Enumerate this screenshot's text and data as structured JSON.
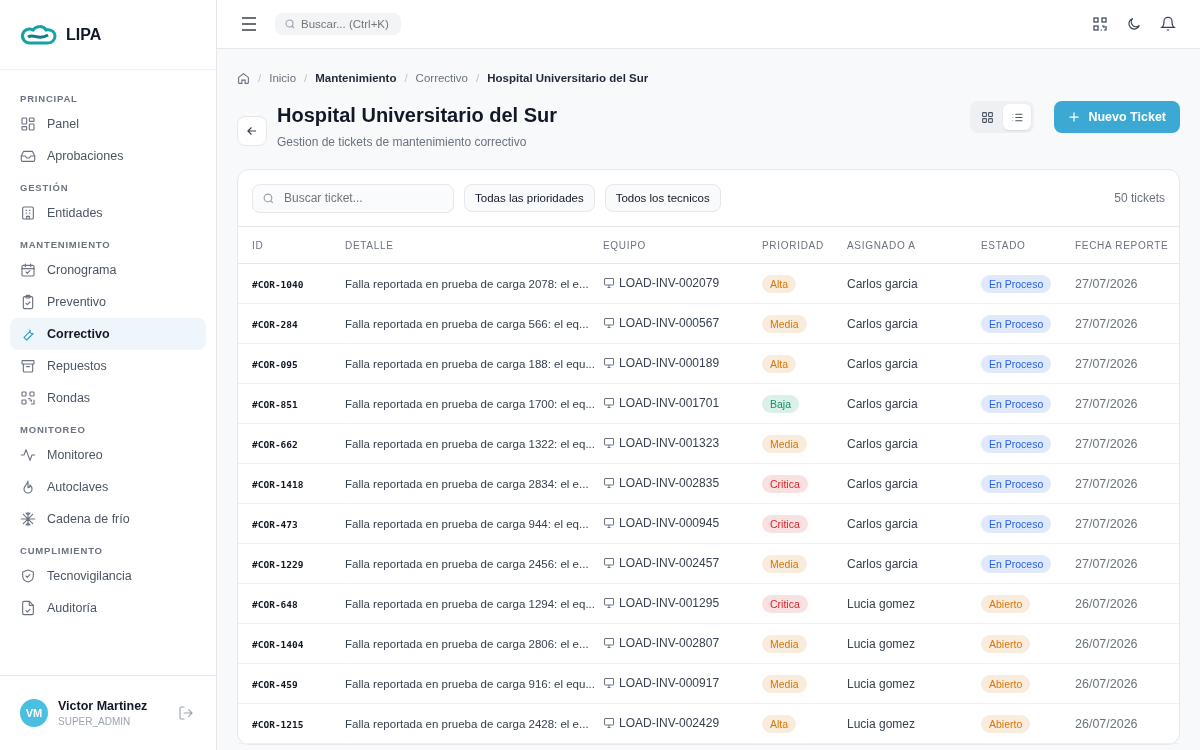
{
  "brand": {
    "name": "LIPA"
  },
  "sidebar": {
    "sections": [
      {
        "title": "PRINCIPAL",
        "items": [
          {
            "label": "Panel",
            "selected": false
          },
          {
            "label": "Aprobaciones",
            "selected": false
          }
        ]
      },
      {
        "title": "GESTIÓN",
        "items": [
          {
            "label": "Entidades",
            "selected": false
          }
        ]
      },
      {
        "title": "MANTENIMIENTO",
        "items": [
          {
            "label": "Cronograma",
            "selected": false
          },
          {
            "label": "Preventivo",
            "selected": false
          },
          {
            "label": "Correctivo",
            "selected": true
          },
          {
            "label": "Repuestos",
            "selected": false
          },
          {
            "label": "Rondas",
            "selected": false
          }
        ]
      },
      {
        "title": "MONITOREO",
        "items": [
          {
            "label": "Monitoreo",
            "selected": false
          },
          {
            "label": "Autoclaves",
            "selected": false
          },
          {
            "label": "Cadena de frío",
            "selected": false
          }
        ]
      },
      {
        "title": "CUMPLIMIENTO",
        "items": [
          {
            "label": "Tecnovigilancia",
            "selected": false
          },
          {
            "label": "Auditoría",
            "selected": false
          }
        ]
      }
    ]
  },
  "user": {
    "initials": "VM",
    "name": "Victor Martinez",
    "role": "SUPER_ADMIN"
  },
  "topbar": {
    "search": {
      "placeholder": "Buscar... (Ctrl+K)"
    }
  },
  "breadcrumb": {
    "separator": "/",
    "items": [
      {
        "label": "Inicio",
        "bold": false
      },
      {
        "label": "Mantenimiento",
        "bold": true
      },
      {
        "label": "Correctivo",
        "bold": false
      },
      {
        "label": "Hospital Universitario del Sur",
        "bold": true
      }
    ]
  },
  "page": {
    "title": "Hospital Universitario del Sur",
    "subtitle": "Gestion de tickets de mantenimiento correctivo"
  },
  "view_toggle": [
    {
      "kind": "grid",
      "selected": false
    },
    {
      "kind": "list",
      "selected": true
    }
  ],
  "new_button": {
    "label": "Nuevo Ticket"
  },
  "filters": {
    "search": {
      "placeholder": "Buscar ticket..."
    },
    "priority": "Todas las prioridades",
    "technician": "Todos los tecnicos",
    "count": "50 tickets"
  },
  "table": {
    "columns": [
      "ID",
      "DETALLE",
      "EQUIPO",
      "PRIORIDAD",
      "ASIGNADO A",
      "ESTADO",
      "FECHA REPORTE"
    ],
    "rows": [
      {
        "id": "#COR-1040",
        "detail": "Falla reportada en prueba de carga 2078: el e...",
        "equipment": "LOAD-INV-002079",
        "priority": {
          "label": "Alta",
          "color": "#d97706"
        },
        "assignee": "Carlos garcia",
        "status": {
          "label": "En Proceso",
          "color": "#2563eb"
        },
        "date": "27/07/2026"
      },
      {
        "id": "#COR-284",
        "detail": "Falla reportada en prueba de carga 566: el eq...",
        "equipment": "LOAD-INV-000567",
        "priority": {
          "label": "Media",
          "color": "#d97706"
        },
        "assignee": "Carlos garcia",
        "status": {
          "label": "En Proceso",
          "color": "#2563eb"
        },
        "date": "27/07/2026"
      },
      {
        "id": "#COR-095",
        "detail": "Falla reportada en prueba de carga 188: el equ...",
        "equipment": "LOAD-INV-000189",
        "priority": {
          "label": "Alta",
          "color": "#d97706"
        },
        "assignee": "Carlos garcia",
        "status": {
          "label": "En Proceso",
          "color": "#2563eb"
        },
        "date": "27/07/2026"
      },
      {
        "id": "#COR-851",
        "detail": "Falla reportada en prueba de carga 1700: el eq...",
        "equipment": "LOAD-INV-001701",
        "priority": {
          "label": "Baja",
          "color": "#059669"
        },
        "assignee": "Carlos garcia",
        "status": {
          "label": "En Proceso",
          "color": "#2563eb"
        },
        "date": "27/07/2026"
      },
      {
        "id": "#COR-662",
        "detail": "Falla reportada en prueba de carga 1322: el eq...",
        "equipment": "LOAD-INV-001323",
        "priority": {
          "label": "Media",
          "color": "#d97706"
        },
        "assignee": "Carlos garcia",
        "status": {
          "label": "En Proceso",
          "color": "#2563eb"
        },
        "date": "27/07/2026"
      },
      {
        "id": "#COR-1418",
        "detail": "Falla reportada en prueba de carga 2834: el e...",
        "equipment": "LOAD-INV-002835",
        "priority": {
          "label": "Critica",
          "color": "#dc2626"
        },
        "assignee": "Carlos garcia",
        "status": {
          "label": "En Proceso",
          "color": "#2563eb"
        },
        "date": "27/07/2026"
      },
      {
        "id": "#COR-473",
        "detail": "Falla reportada en prueba de carga 944: el eq...",
        "equipment": "LOAD-INV-000945",
        "priority": {
          "label": "Critica",
          "color": "#dc2626"
        },
        "assignee": "Carlos garcia",
        "status": {
          "label": "En Proceso",
          "color": "#2563eb"
        },
        "date": "27/07/2026"
      },
      {
        "id": "#COR-1229",
        "detail": "Falla reportada en prueba de carga 2456: el e...",
        "equipment": "LOAD-INV-002457",
        "priority": {
          "label": "Media",
          "color": "#d97706"
        },
        "assignee": "Carlos garcia",
        "status": {
          "label": "En Proceso",
          "color": "#2563eb"
        },
        "date": "27/07/2026"
      },
      {
        "id": "#COR-648",
        "detail": "Falla reportada en prueba de carga 1294: el eq...",
        "equipment": "LOAD-INV-001295",
        "priority": {
          "label": "Critica",
          "color": "#dc2626"
        },
        "assignee": "Lucia gomez",
        "status": {
          "label": "Abierto",
          "color": "#d97706"
        },
        "date": "26/07/2026"
      },
      {
        "id": "#COR-1404",
        "detail": "Falla reportada en prueba de carga 2806: el e...",
        "equipment": "LOAD-INV-002807",
        "priority": {
          "label": "Media",
          "color": "#d97706"
        },
        "assignee": "Lucia gomez",
        "status": {
          "label": "Abierto",
          "color": "#d97706"
        },
        "date": "26/07/2026"
      },
      {
        "id": "#COR-459",
        "detail": "Falla reportada en prueba de carga 916: el equ...",
        "equipment": "LOAD-INV-000917",
        "priority": {
          "label": "Media",
          "color": "#d97706"
        },
        "assignee": "Lucia gomez",
        "status": {
          "label": "Abierto",
          "color": "#d97706"
        },
        "date": "26/07/2026"
      },
      {
        "id": "#COR-1215",
        "detail": "Falla reportada en prueba de carga 2428: el e...",
        "equipment": "LOAD-INV-002429",
        "priority": {
          "label": "Alta",
          "color": "#d97706"
        },
        "assignee": "Lucia gomez",
        "status": {
          "label": "Abierto",
          "color": "#d97706"
        },
        "date": "26/07/2026"
      }
    ]
  }
}
